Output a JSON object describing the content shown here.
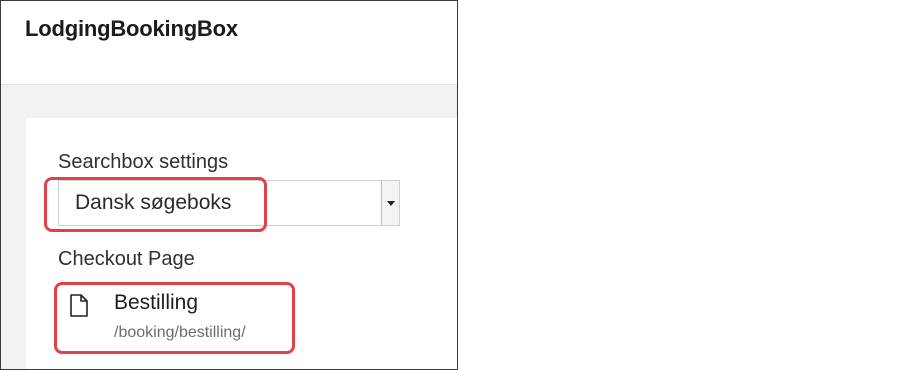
{
  "header": {
    "title": "LodgingBookingBox"
  },
  "searchbox": {
    "label": "Searchbox settings",
    "selected_value": "Dansk søgeboks"
  },
  "checkout": {
    "label": "Checkout Page",
    "page_name": "Bestilling",
    "page_path": "/booking/bestilling/",
    "icon": "document-icon"
  },
  "colors": {
    "highlight": "#e2414a",
    "frame_border": "#3a3a3a",
    "background": "#f2f2f2"
  }
}
